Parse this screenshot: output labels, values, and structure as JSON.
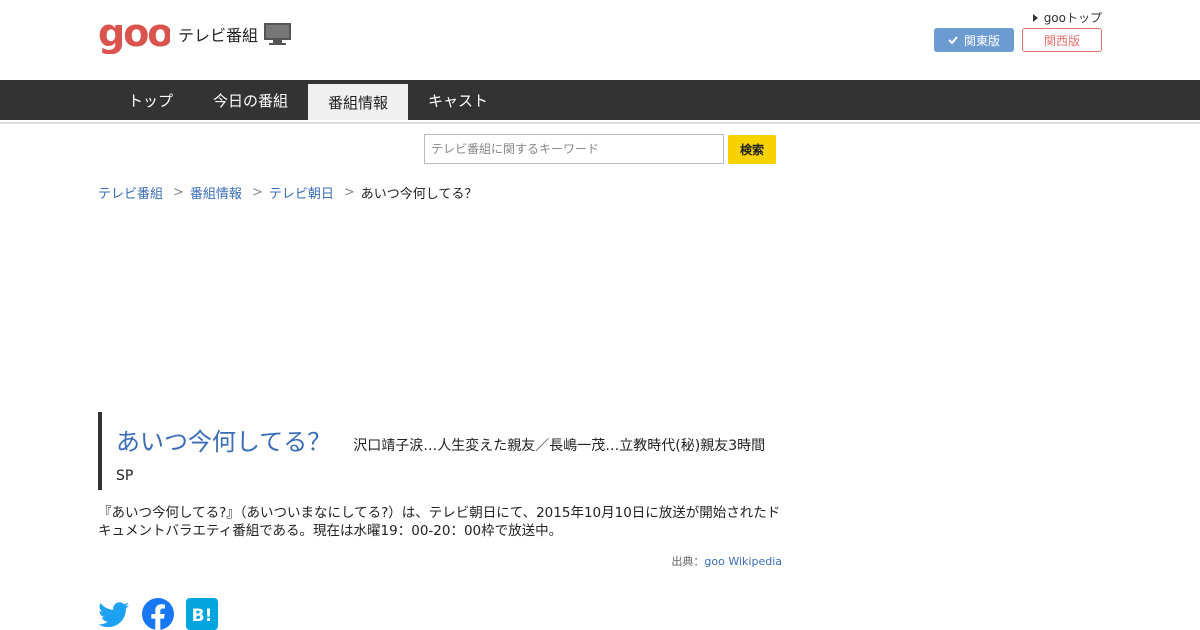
{
  "header": {
    "logo_text": "goo",
    "site_name": "テレビ番組",
    "goo_top_label": "gooトップ",
    "region_kanto": "関東版",
    "region_kansai": "関西版"
  },
  "nav": {
    "tabs": [
      {
        "label": "トップ"
      },
      {
        "label": "今日の番組"
      },
      {
        "label": "番組情報",
        "active": true
      },
      {
        "label": "キャスト"
      }
    ]
  },
  "search": {
    "placeholder": "テレビ番組に関するキーワード",
    "button_label": "検索"
  },
  "breadcrumb": {
    "items": [
      "テレビ番組",
      "番組情報",
      "テレビ朝日"
    ],
    "separator": ">",
    "current": "あいつ今何してる？"
  },
  "program": {
    "title": "あいつ今何してる？",
    "subtitle": "沢口靖子涙…人生変えた親友／長嶋一茂…立教時代(秘)親友3時間SP",
    "description": "『あいつ今何してる?』（あいついまなにしてる?）は、テレビ朝日にて、2015年10月10日に放送が開始されたドキュメントバラエティ番組である。現在は水曜19：00-20：00枠で放送中。",
    "source_prefix": "出典：",
    "source_link": "goo Wikipedia"
  },
  "colors": {
    "accent_blue": "#3a6db5",
    "nav_bg": "#333333",
    "search_btn": "#f5d200",
    "logo_red": "#d9534f",
    "kanto_bg": "#6b9bd1",
    "kansai_border": "#e07070",
    "twitter": "#1da1f2",
    "facebook": "#1877f2",
    "hatena": "#00a4de"
  },
  "social": {
    "icons": [
      "twitter-icon",
      "facebook-icon",
      "hatena-bookmark-icon"
    ],
    "hatena_text": "B!"
  }
}
